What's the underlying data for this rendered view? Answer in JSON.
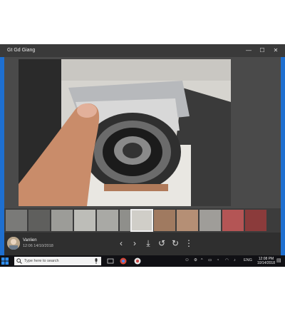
{
  "window": {
    "title": "Gt Gd Giang",
    "minimize_glyph": "—",
    "maximize_glyph": "☐",
    "close_glyph": "✕"
  },
  "filmstrip": {
    "thumbnails": [
      "thumb-1",
      "thumb-2",
      "thumb-3",
      "thumb-4",
      "thumb-5",
      "thumb-6",
      "thumb-7",
      "thumb-8",
      "thumb-9",
      "thumb-10",
      "thumb-11",
      "thumb-12"
    ],
    "selected_index": 6
  },
  "uploader": {
    "name": "Vanlien",
    "datetime": "12:06 14/10/2018"
  },
  "toolbar": {
    "prev_glyph": "‹",
    "next_glyph": "›",
    "download_glyph": "⤓",
    "rotate_left_glyph": "↺",
    "rotate_right_glyph": "↻",
    "more_glyph": "⋮"
  },
  "taskbar": {
    "search_placeholder": "Type here to search",
    "language": "ENG",
    "time": "12:08 PM",
    "date": "10/14/2018"
  },
  "colors": {
    "taskbar_bg": "#101014",
    "accent_blue": "#1e6fd0"
  }
}
